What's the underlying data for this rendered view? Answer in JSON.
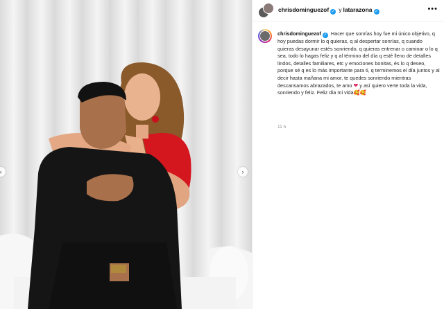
{
  "header": {
    "username": "chrisdominguezof",
    "connector": "y",
    "collab_username": "latarazona"
  },
  "post": {
    "username": "chrisdominguezof",
    "caption": "Hacer que sonrías hoy fue mi único objetivo, q hoy puedas dormir lo q quieras, q al despertar sonrías, q cuando quieras desayunar estés sonriendo, q quieras entrenar o caminar o lo q sea, todo lo hagas feliz y q al término del día q esté lleno de detalles lindos, detalles familiares, etc y emociones bonitas, és lo q deseo, porque sé q es lo más importante para ti, q terminemos el día juntos y al decir hasta mañana mi amor, te quedes sonriendo mientras descansamos abrazados, te amo",
    "caption_tail": "y así quiero verte toda la vida, sonriendo y feliz. Feliz día mi vida🥰🥰",
    "timestamp": "11 h"
  },
  "icons": {
    "verified": "verified-badge-icon",
    "more": "more-options-icon",
    "heart": "red-heart-icon",
    "prev": "chevron-left-icon",
    "next": "chevron-right-icon"
  },
  "colors": {
    "verified": "#1d9bf0",
    "heart": "#e0245e",
    "dress": "#d4161f"
  }
}
